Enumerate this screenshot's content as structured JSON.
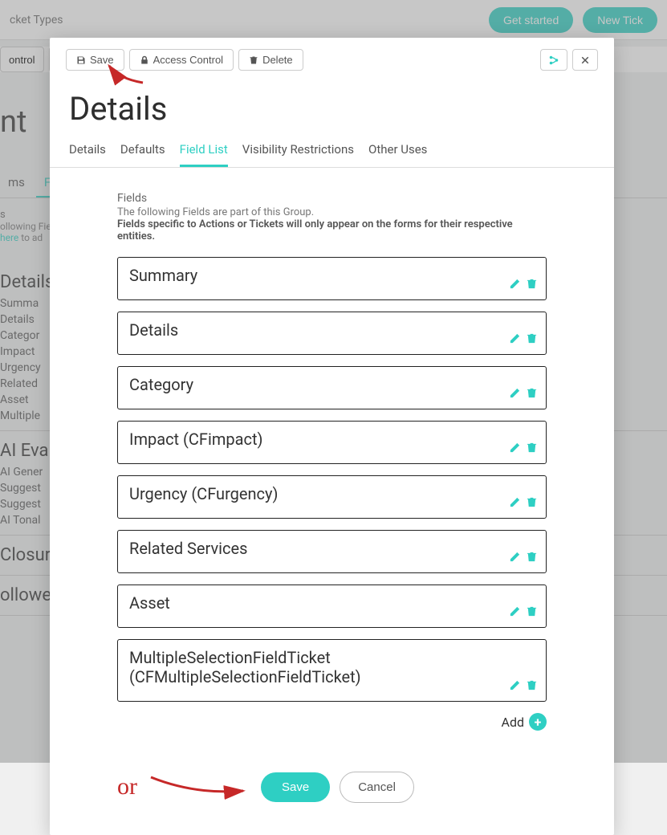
{
  "background": {
    "ticket_types": "cket Types",
    "get_started": "Get started",
    "new_ticket": "New Tick",
    "toolbar_btn1": "ontrol",
    "title": "nt",
    "tabs": {
      "ms": "ms",
      "field": "Fiel"
    },
    "fields_label": "s",
    "fields_hint1": "ollowing Fiel",
    "fields_link": "here",
    "fields_hint2": " to ad",
    "sections": {
      "details": {
        "title": "Details",
        "items": [
          "Summa",
          "Details",
          "Categor",
          "Impact",
          "Urgency",
          "Related",
          "Asset",
          "Multiple"
        ]
      },
      "ai": {
        "title": "AI Evalu",
        "items": [
          "AI Gener",
          "Suggest",
          "Suggest",
          "AI Tonal"
        ]
      },
      "closure": {
        "title": "Closure"
      },
      "follower": {
        "title": "ollower"
      }
    }
  },
  "modal": {
    "toolbar": {
      "save": "Save",
      "access_control": "Access Control",
      "delete": "Delete"
    },
    "title": "Details",
    "tabs": [
      "Details",
      "Defaults",
      "Field List",
      "Visibility Restrictions",
      "Other Uses"
    ],
    "active_tab_index": 2,
    "fields_label": "Fields",
    "fields_desc": "The following Fields are part of this Group.",
    "fields_note": "Fields specific to Actions or Tickets will only appear on the forms for their respective entities.",
    "fields": [
      {
        "name": "Summary"
      },
      {
        "name": "Details"
      },
      {
        "name": "Category"
      },
      {
        "name": "Impact (CFimpact)"
      },
      {
        "name": "Urgency (CFurgency)"
      },
      {
        "name": "Related Services"
      },
      {
        "name": "Asset"
      },
      {
        "name": "MultipleSelectionFieldTicket (CFMultipleSelectionFieldTicket)"
      }
    ],
    "add_label": "Add",
    "footer": {
      "save": "Save",
      "cancel": "Cancel"
    }
  },
  "annotations": {
    "or": "or"
  }
}
